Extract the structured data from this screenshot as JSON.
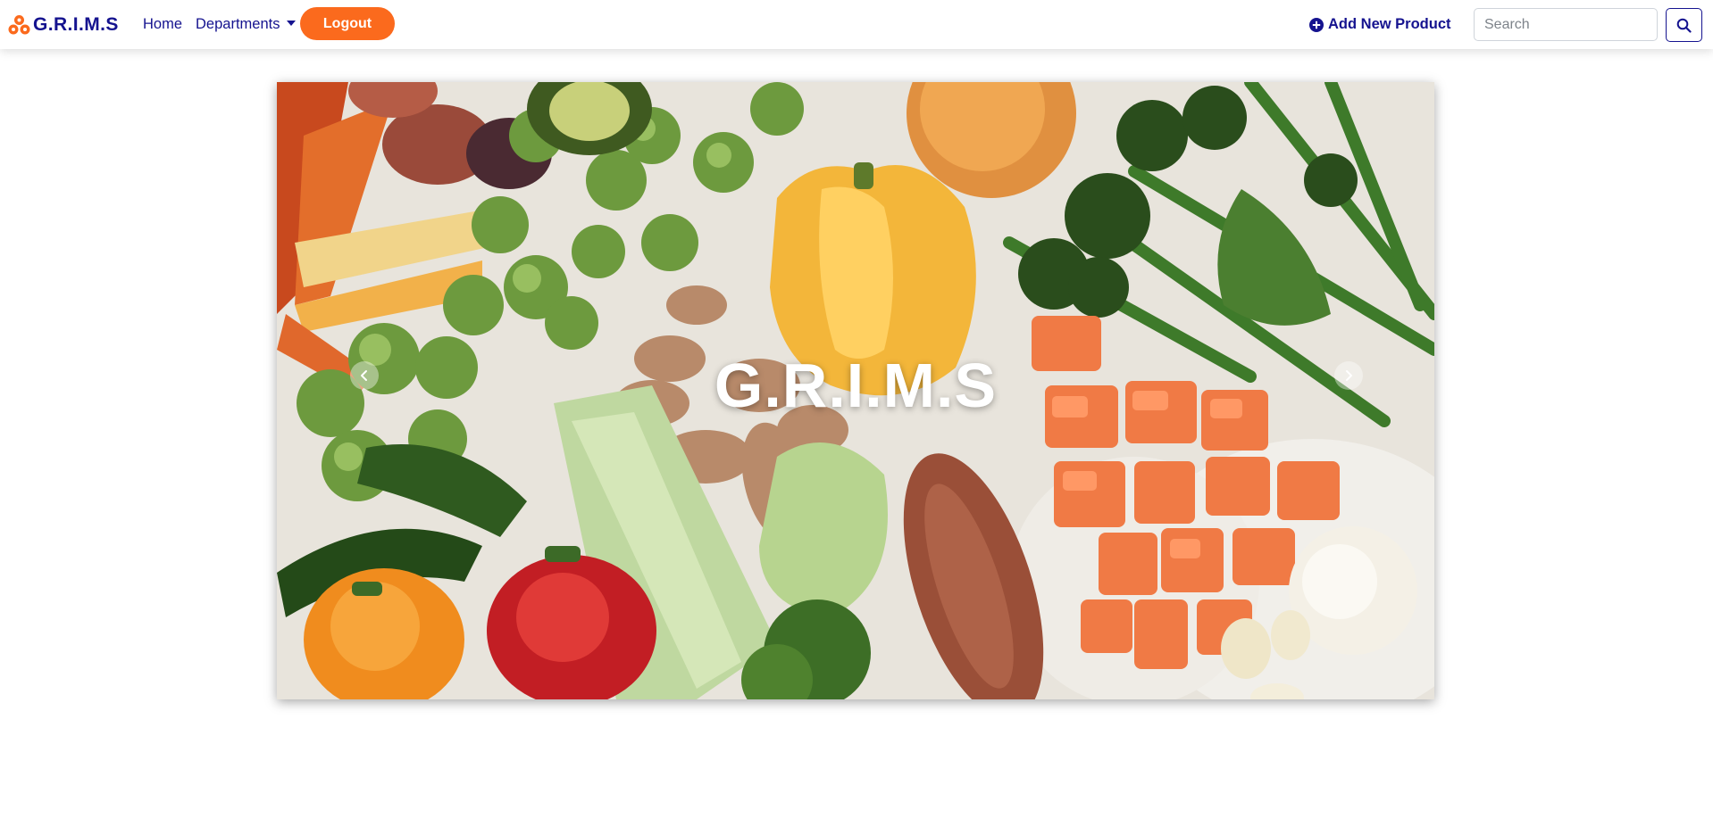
{
  "navbar": {
    "brand": "G.R.I.M.S",
    "links": {
      "home": "Home",
      "departments": "Departments"
    },
    "logout_label": "Logout",
    "add_product_label": "Add New Product",
    "search": {
      "placeholder": "Search",
      "value": ""
    }
  },
  "hero": {
    "title": "G.R.I.M.S"
  },
  "colors": {
    "brand_navy": "#15138f",
    "accent_orange": "#fb6a1d"
  },
  "icons": {
    "brand": "cubes-icon",
    "add_product": "plus-circle-icon",
    "search": "search-icon",
    "prev": "chevron-left-icon",
    "next": "chevron-right-icon"
  }
}
